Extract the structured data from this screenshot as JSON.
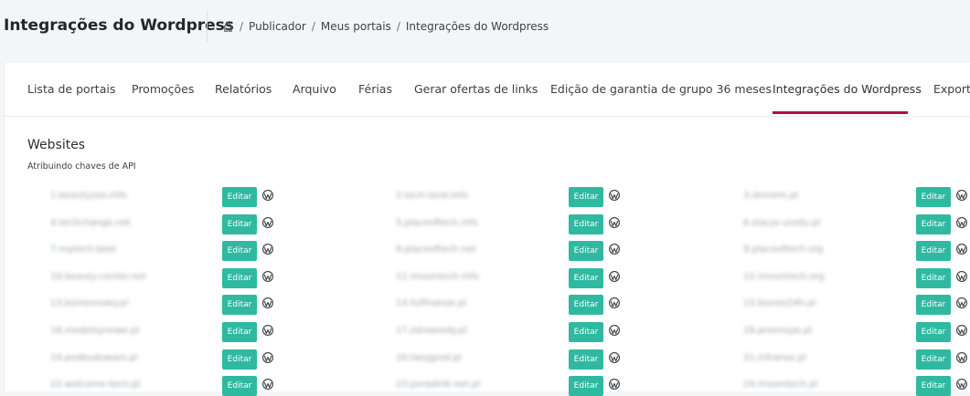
{
  "header": {
    "title": "Integrações do Wordpress",
    "breadcrumb": [
      "Publicador",
      "Meus portais",
      "Integrações do Wordpress"
    ]
  },
  "tabs": [
    {
      "label": "Lista de portais",
      "active": false
    },
    {
      "label": "Promoções",
      "active": false
    },
    {
      "label": "Relatórios",
      "active": false
    },
    {
      "label": "Arquivo",
      "active": false
    },
    {
      "label": "Férias",
      "active": false
    },
    {
      "label": "Gerar ofertas de links",
      "active": false
    },
    {
      "label": "Edição de garantia de grupo 36 meses",
      "active": false
    },
    {
      "label": "Integrações do Wordpress",
      "active": true
    },
    {
      "label": "Exportar",
      "active": false
    }
  ],
  "section": {
    "title": "Websites",
    "subtitle": "Atribuindo chaves de API"
  },
  "edit_label": "Editar",
  "accent_color": "#b0123f",
  "button_color": "#2fb9a0",
  "websites": [
    [
      "1.beautyzoo.info",
      "2.tech-land.info",
      "3.domem.pl"
    ],
    [
      "4.techchange.net",
      "5.placeoftech.info",
      "6.stacja-urodu.pl"
    ],
    [
      "7.mytech.best",
      "8.placeoftech.net",
      "9.placeoftech.org"
    ],
    [
      "10.beauty-center.net",
      "11.imoontech.info",
      "12.imoontech.org"
    ],
    [
      "13.biznesnowy.pl",
      "14.fulfinanse.pl",
      "15.biznes24h.pl"
    ],
    [
      "16.modelsynowe.pl",
      "17.zdrowiedy.pl",
      "18.promoyje.pl"
    ],
    [
      "19.podbudowani.pl",
      "20.twojgrod.pl",
      "21.infranse.pl"
    ],
    [
      "22.welcome-tech.pl",
      "23.poradnik-net.pl",
      "24.imoontech.pl"
    ]
  ]
}
